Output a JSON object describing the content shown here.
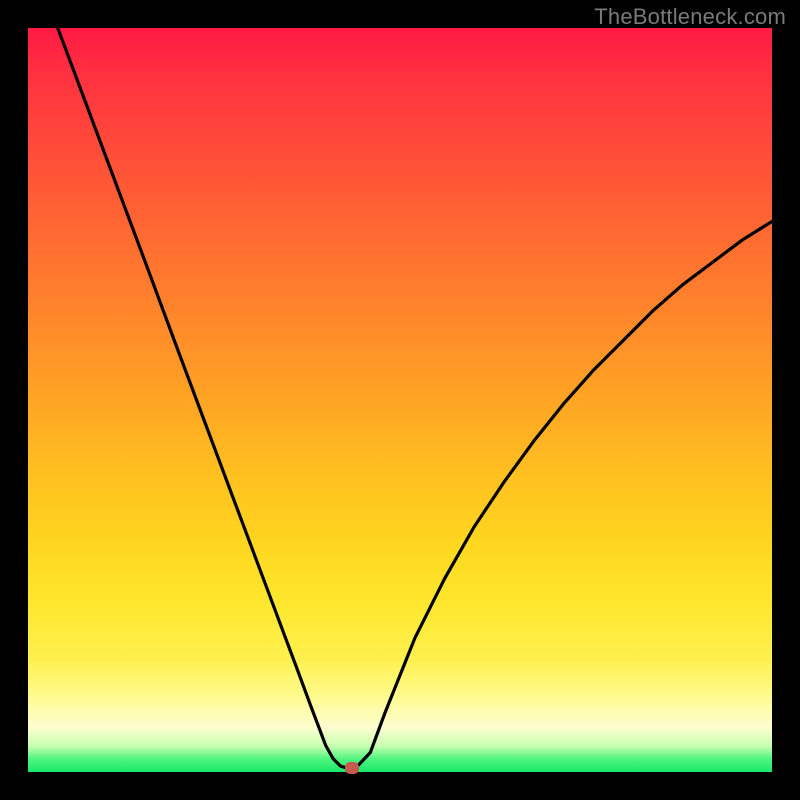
{
  "watermark": "TheBottleneck.com",
  "colors": {
    "frame": "#000000",
    "curve_stroke": "#000000",
    "marker": "#c65a4f"
  },
  "chart_data": {
    "type": "line",
    "title": "",
    "xlabel": "",
    "ylabel": "",
    "xlim": [
      0,
      100
    ],
    "ylim": [
      0,
      100
    ],
    "grid": false,
    "legend": false,
    "series": [
      {
        "name": "bottleneck-curve",
        "x": [
          4,
          8,
          12,
          16,
          20,
          24,
          28,
          32,
          36,
          38,
          40,
          41,
          42,
          43,
          44,
          46,
          48,
          52,
          56,
          60,
          64,
          68,
          72,
          76,
          80,
          84,
          88,
          92,
          96,
          100
        ],
        "y": [
          100,
          89.3,
          78.6,
          67.9,
          57.1,
          46.4,
          35.7,
          25.0,
          14.3,
          8.9,
          3.6,
          1.8,
          0.8,
          0.5,
          0.5,
          2.6,
          8.0,
          18.0,
          26.0,
          33.0,
          39.0,
          44.5,
          49.5,
          54.0,
          58.0,
          62.0,
          65.5,
          68.5,
          71.5,
          74.0
        ]
      }
    ],
    "marker": {
      "x": 43.5,
      "y": 0.5
    },
    "gradient_stops": [
      {
        "pos": 0,
        "color": "#ff1a44"
      },
      {
        "pos": 0.5,
        "color": "#ffa524"
      },
      {
        "pos": 0.9,
        "color": "#fffb90"
      },
      {
        "pos": 1.0,
        "color": "#18e86a"
      }
    ]
  }
}
